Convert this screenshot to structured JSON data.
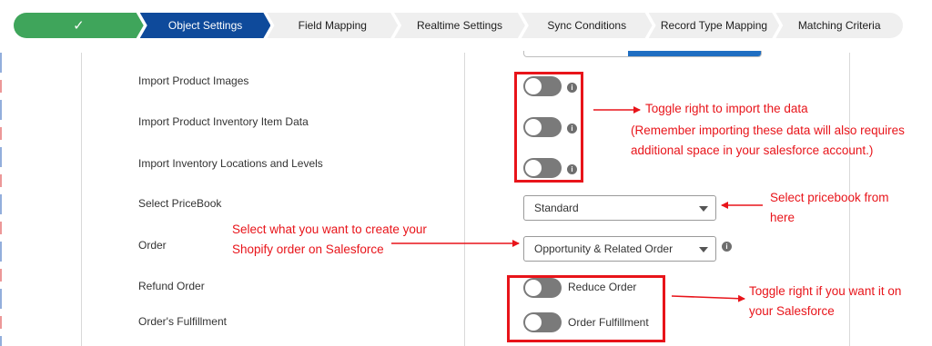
{
  "steps": [
    {
      "label": "✓",
      "state": "done"
    },
    {
      "label": "Object Settings",
      "state": "active"
    },
    {
      "label": "Field Mapping",
      "state": "todo"
    },
    {
      "label": "Realtime Settings",
      "state": "todo"
    },
    {
      "label": "Sync Conditions",
      "state": "todo"
    },
    {
      "label": "Record Type Mapping",
      "state": "todo"
    },
    {
      "label": "Matching Criteria",
      "state": "todo"
    }
  ],
  "form": {
    "import_product_images": "Import Product Images",
    "import_inventory_item_data": "Import Product Inventory Item Data",
    "import_inventory_locations": "Import Inventory Locations and Levels",
    "select_pricebook": "Select PriceBook",
    "order": "Order",
    "refund_order": "Refund Order",
    "orders_fulfillment": "Order's Fulfillment",
    "pricebook_value": "Standard",
    "order_value": "Opportunity & Related Order",
    "reduce_order": "Reduce Order",
    "order_fulfillment": "Order Fulfillment",
    "info_glyph": "i"
  },
  "annotations": {
    "toggle_import": "Toggle right to import the data",
    "remember_line1": "(Remember importing these data will also requires",
    "remember_line2": "additional space in your salesforce account.)",
    "pricebook_line1": "Select pricebook from",
    "pricebook_line2": "here",
    "order_line1": "Select what you want to create your",
    "order_line2": "Shopify order on Salesforce",
    "toggle_sf_line1": "Toggle right if you want it on",
    "toggle_sf_line2": "your Salesforce"
  },
  "colors": {
    "done": "#3fa55b",
    "active": "#0e4a9b",
    "todo": "#efefef",
    "annotation": "#e8141a",
    "toggle_off": "#7a7a7a"
  }
}
